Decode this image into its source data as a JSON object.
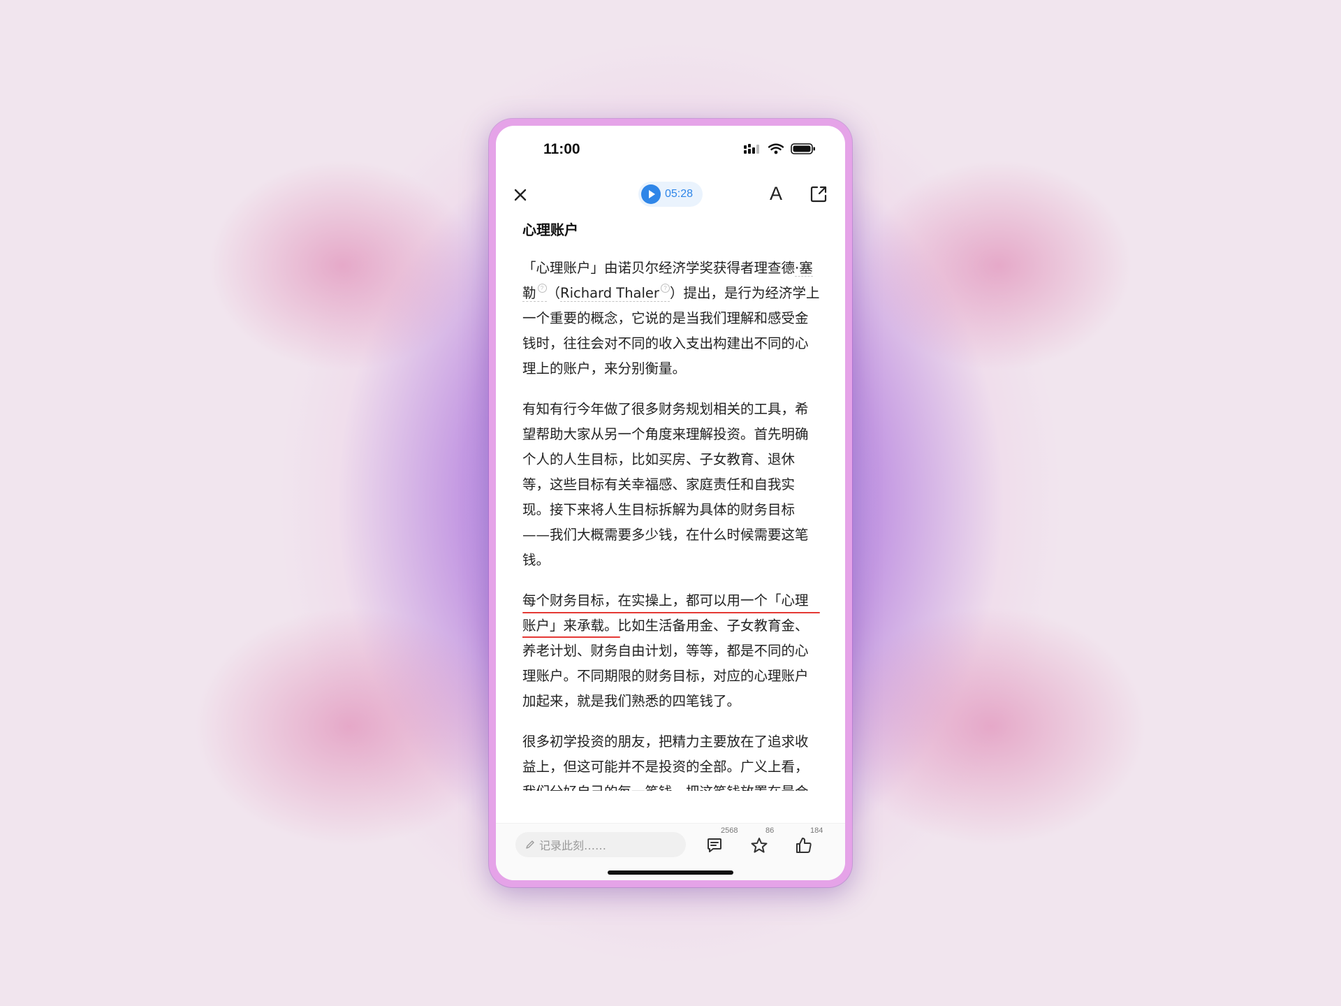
{
  "status_bar": {
    "time": "11:00"
  },
  "toolbar": {
    "audio_duration": "05:28",
    "font_button_label": "A"
  },
  "article": {
    "title": "心理账户",
    "p1": {
      "part1": "「心理账户」由诺贝尔经济学奖获得者理查德",
      "glossary1": "·塞勒",
      "part2": "（",
      "glossary2": "Richard Thaler",
      "part3": "）提出，是行为经济学上一个重要的概念，它说的是当我们理解和感受金钱时，往往会对不同的收入支出构建出不同的心理上的账户，来分别衡量。",
      "hint_mark": "?"
    },
    "p2": "有知有行今年做了很多财务规划相关的工具，希望帮助大家从另一个角度来理解投资。首先明确个人的人生目标，比如买房、子女教育、退休等，这些目标有关幸福感、家庭责任和自我实现。接下来将人生目标拆解为具体的财务目标——我们大概需要多少钱，在什么时候需要这笔钱。",
    "p3": {
      "highlighted": "每个财务目标，在实操上，都可以用一个「心理账户」来承载。",
      "rest": "比如生活备用金、子女教育金、养老计划、财务自由计划，等等，都是不同的心理账户。不同期限的财务目标，对应的心理账户加起来，就是我们熟悉的四笔钱了。"
    },
    "p4": "很多初学投资的朋友，把精力主要放在了追求收益上，但这可能并不是投资的全部。广义上看，我们分好自己的每一笔钱，把这笔钱放置在最合适的去处，就已经在投资了。工资到账"
  },
  "bottom_bar": {
    "note_placeholder": "记录此刻……",
    "comment_count": "2568",
    "favorite_count": "86",
    "like_count": "184"
  },
  "icons": {
    "close": "close-icon",
    "play": "play-icon",
    "share": "share-icon",
    "pencil": "pencil-icon",
    "comment": "comment-icon",
    "star": "star-icon",
    "like": "thumbs-up-icon"
  },
  "colors": {
    "accent": "#2f86e8",
    "highlight": "#e53935",
    "text": "#222222"
  }
}
